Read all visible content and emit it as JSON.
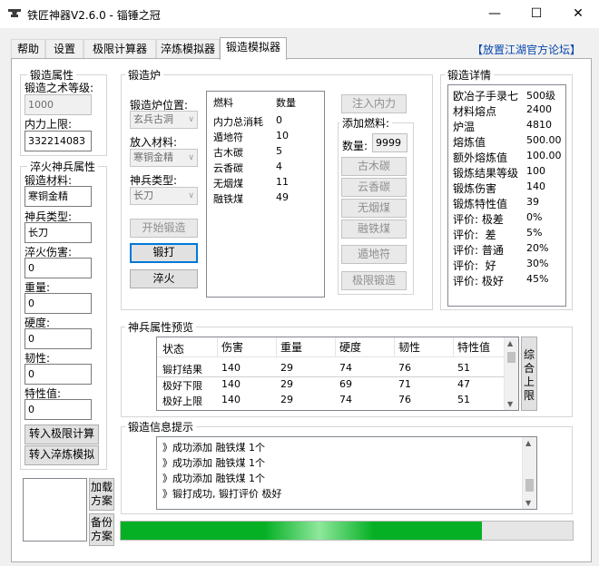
{
  "window": {
    "title": "铁匠神器V2.6.0 - 锱锤之冠",
    "minimize": "—",
    "maximize": "☐",
    "close": "✕"
  },
  "tabs": [
    {
      "label": "帮助"
    },
    {
      "label": "设置"
    },
    {
      "label": "极限计算器"
    },
    {
      "label": "淬炼模拟器"
    },
    {
      "label": "锻造模拟器"
    }
  ],
  "forum_link": "【放置江湖官方论坛】",
  "forge_attr": {
    "title": "锻造属性",
    "level_label": "锻造之术等级:",
    "level_value": "1000",
    "neili_label": "内力上限:",
    "neili_value": "332214083"
  },
  "quench_attr": {
    "title": "淬火神兵属性",
    "material_label": "锻造材料:",
    "material_value": "寒铜金精",
    "type_label": "神兵类型:",
    "type_value": "长刀",
    "damage_label": "淬火伤害:",
    "damage_value": "0",
    "weight_label": "重量:",
    "weight_value": "0",
    "hardness_label": "硬度:",
    "hardness_value": "0",
    "toughness_label": "韧性:",
    "toughness_value": "0",
    "trait_label": "特性值:",
    "trait_value": "0",
    "btn_to_limit": "转入极限计算",
    "btn_to_quench": "转入淬炼模拟"
  },
  "scheme": {
    "load_label": "加载方案",
    "backup_label": "备份方案"
  },
  "furnace": {
    "title": "锻造炉",
    "position_label": "锻造炉位置:",
    "position_value": "玄兵古洞",
    "material_label": "放入材料:",
    "material_value": "寒铜金精",
    "type_label": "神兵类型:",
    "type_value": "长刀",
    "btn_start": "开始锻造",
    "btn_forge": "锻打",
    "btn_quench": "淬火",
    "fuel_header": "燃料",
    "count_header": "数量",
    "fuels": [
      {
        "name": "内力总消耗",
        "count": "0"
      },
      {
        "name": "遁地符",
        "count": "10"
      },
      {
        "name": "古木碳",
        "count": "5"
      },
      {
        "name": "云香碳",
        "count": "4"
      },
      {
        "name": "无烟煤",
        "count": "11"
      },
      {
        "name": "融铁煤",
        "count": "49"
      }
    ],
    "btn_inject": "注入内力",
    "add_fuel_label": "添加燃料:",
    "qty_label": "数量:",
    "qty_value": "9999",
    "btn_gumu": "古木碳",
    "btn_yunxiang": "云香碳",
    "btn_wuyan": "无烟煤",
    "btn_rongtie": "融铁煤",
    "btn_dundi": "遁地符",
    "btn_limit": "极限锻造"
  },
  "details": {
    "title": "锻造详情",
    "rows": [
      {
        "k": "欧冶子手录七",
        "v": "500级"
      },
      {
        "k": "材料熔点",
        "v": "2400"
      },
      {
        "k": "炉温",
        "v": "4810"
      },
      {
        "k": "熔炼值",
        "v": "500.00"
      },
      {
        "k": "额外熔炼值",
        "v": "100.00"
      },
      {
        "k": "锻炼结果等级",
        "v": "100"
      },
      {
        "k": "锻炼伤害",
        "v": "140"
      },
      {
        "k": "锻炼特性值",
        "v": "39"
      },
      {
        "k": "评价: 极差",
        "v": "0%"
      },
      {
        "k": "评价:  差",
        "v": "5%"
      },
      {
        "k": "评价: 普通",
        "v": "20%"
      },
      {
        "k": "评价:  好",
        "v": "30%"
      },
      {
        "k": "评价: 极好",
        "v": "45%"
      }
    ]
  },
  "preview": {
    "title": "神兵属性预览",
    "headers": [
      "状态",
      "伤害",
      "重量",
      "硬度",
      "韧性",
      "特性值"
    ],
    "rows": [
      [
        "锻打结果",
        "140",
        "29",
        "74",
        "76",
        "51"
      ],
      [
        "极好下限",
        "140",
        "29",
        "69",
        "71",
        "47"
      ],
      [
        "极好上限",
        "140",
        "29",
        "74",
        "76",
        "51"
      ]
    ],
    "btn_side": "综合上限"
  },
  "log": {
    "title": "锻造信息提示",
    "lines": [
      "》成功添加 融铁煤 1个",
      "》成功添加 融铁煤 1个",
      "》成功添加 融铁煤 1个",
      "》锻打成功, 锻打评价 极好"
    ]
  },
  "progress": {
    "fraction": 0.8
  }
}
